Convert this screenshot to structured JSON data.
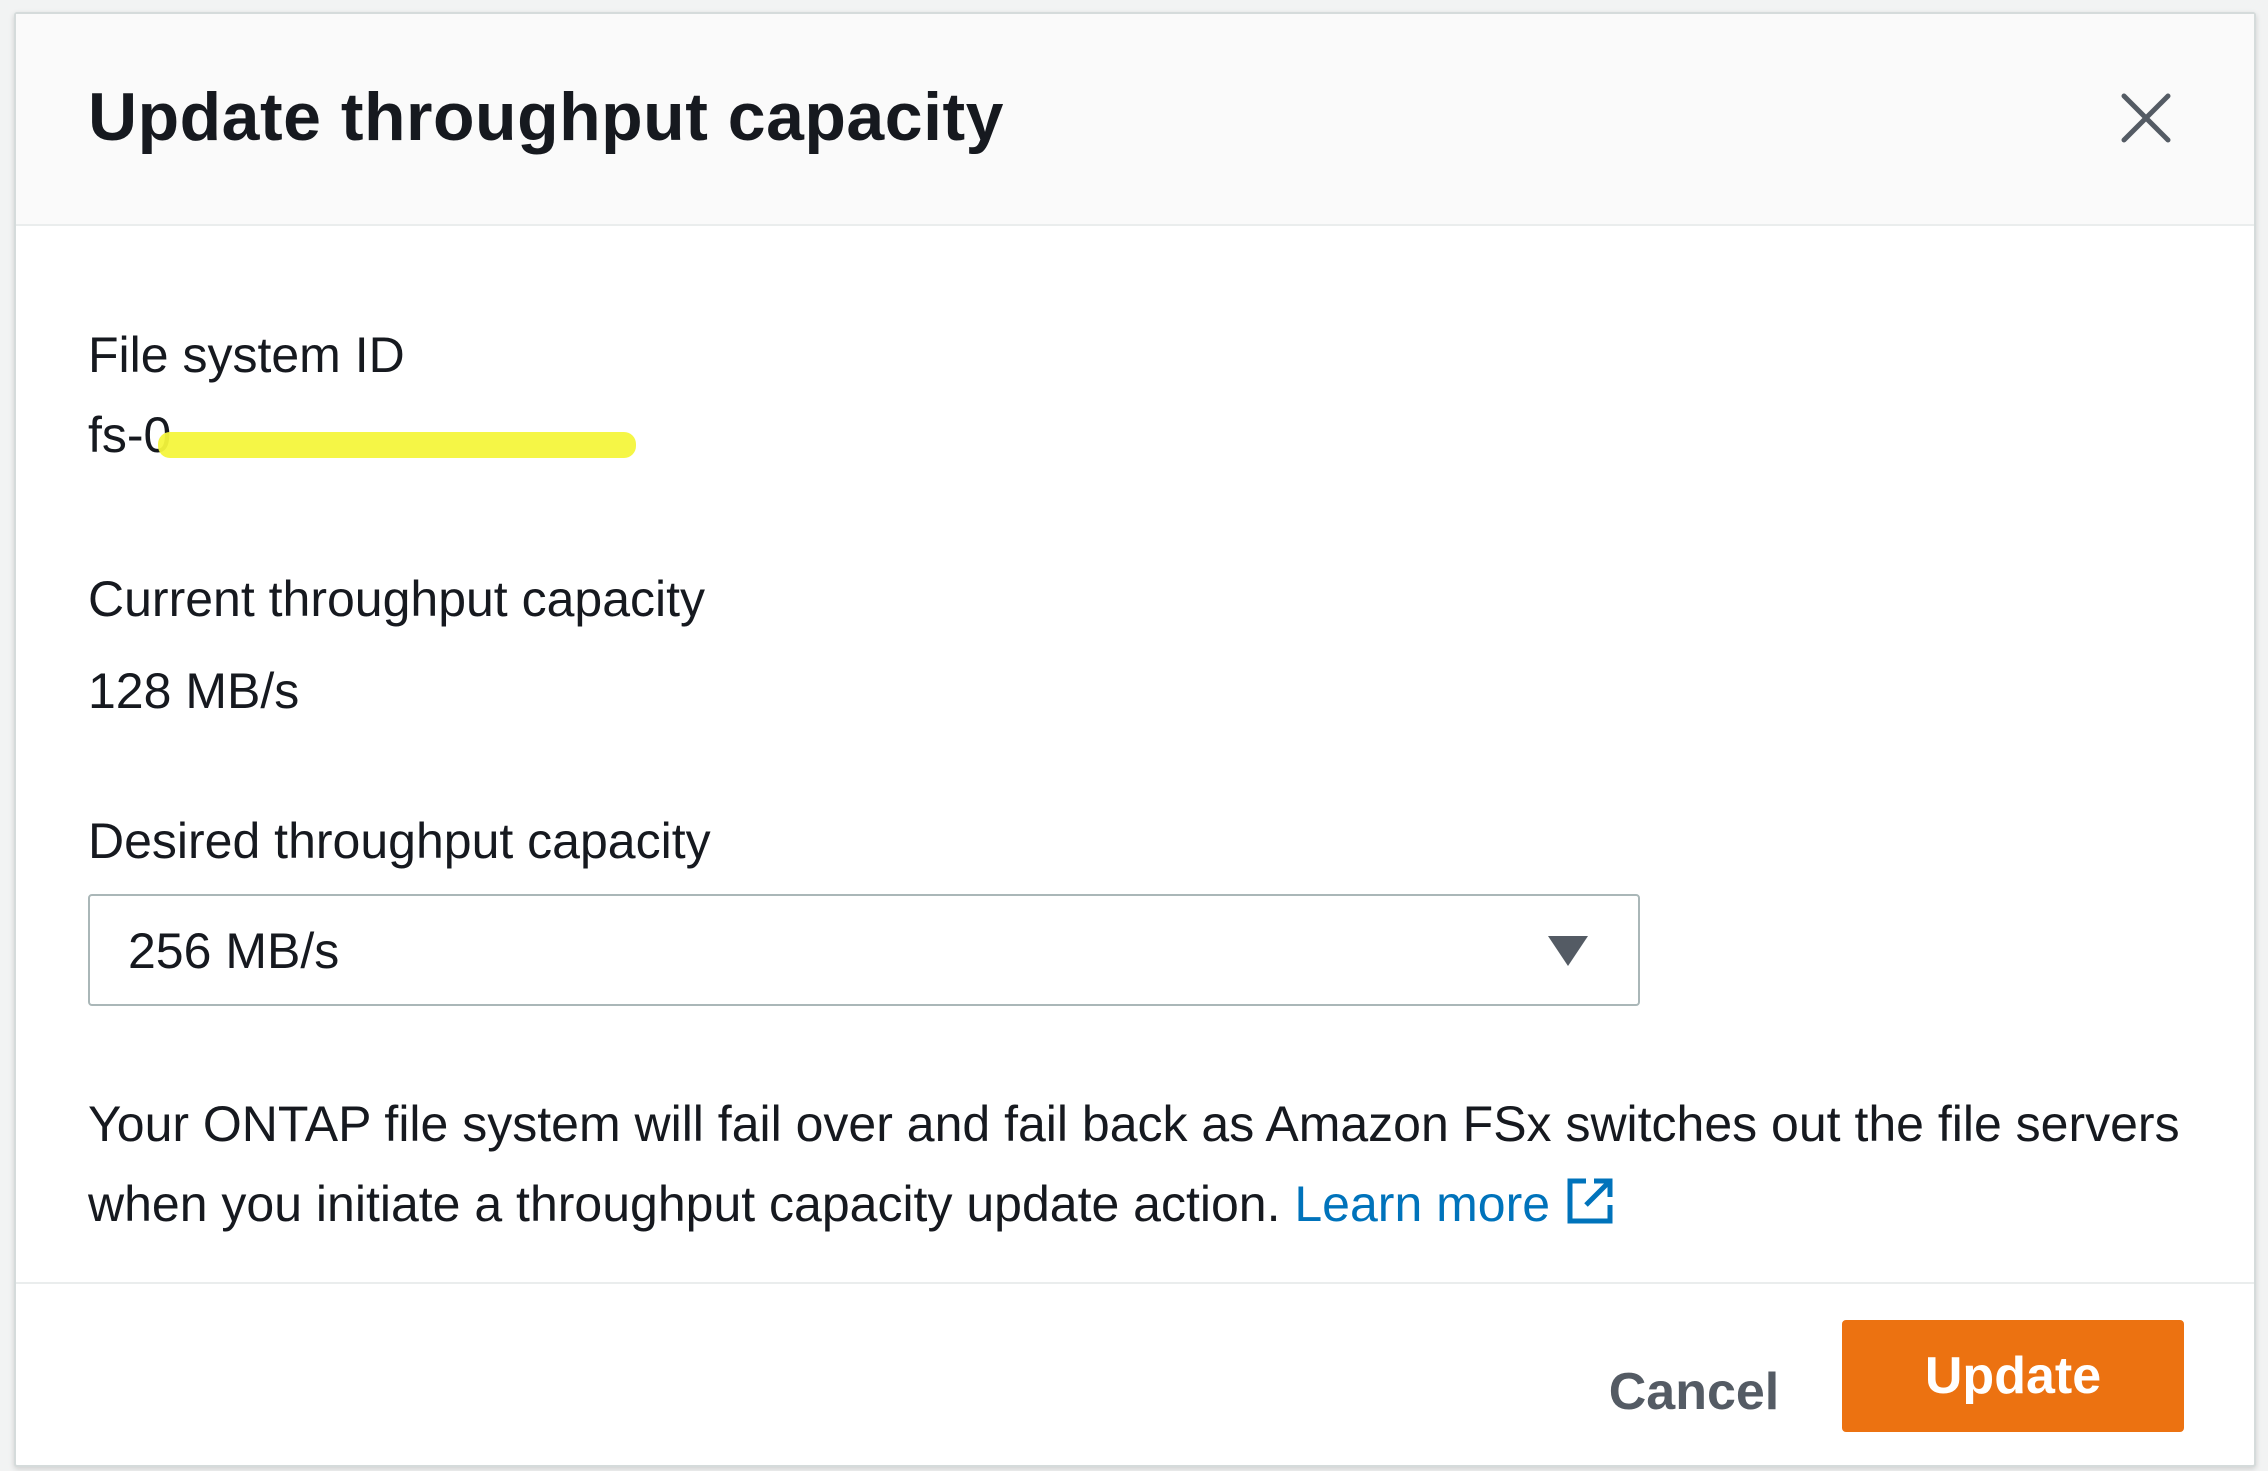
{
  "dialog": {
    "title": "Update throughput capacity",
    "close_icon": "close-icon"
  },
  "fields": {
    "file_system_id_label": "File system ID",
    "file_system_id_value": "fs-0",
    "current_throughput_label": "Current throughput capacity",
    "current_throughput_value": "128 MB/s",
    "desired_throughput_label": "Desired throughput capacity",
    "desired_throughput_selected": "256 MB/s"
  },
  "notice": {
    "text": "Your ONTAP file system will fail over and fail back as Amazon FSx switches out the file servers when you initiate a throughput capacity update action.",
    "link_label": "Learn more",
    "link_icon": "external-link-icon"
  },
  "footer": {
    "cancel_label": "Cancel",
    "update_label": "Update"
  },
  "colors": {
    "primary_button": "#ec7211",
    "link": "#0073bb",
    "redaction_highlight": "#f4f53c"
  }
}
